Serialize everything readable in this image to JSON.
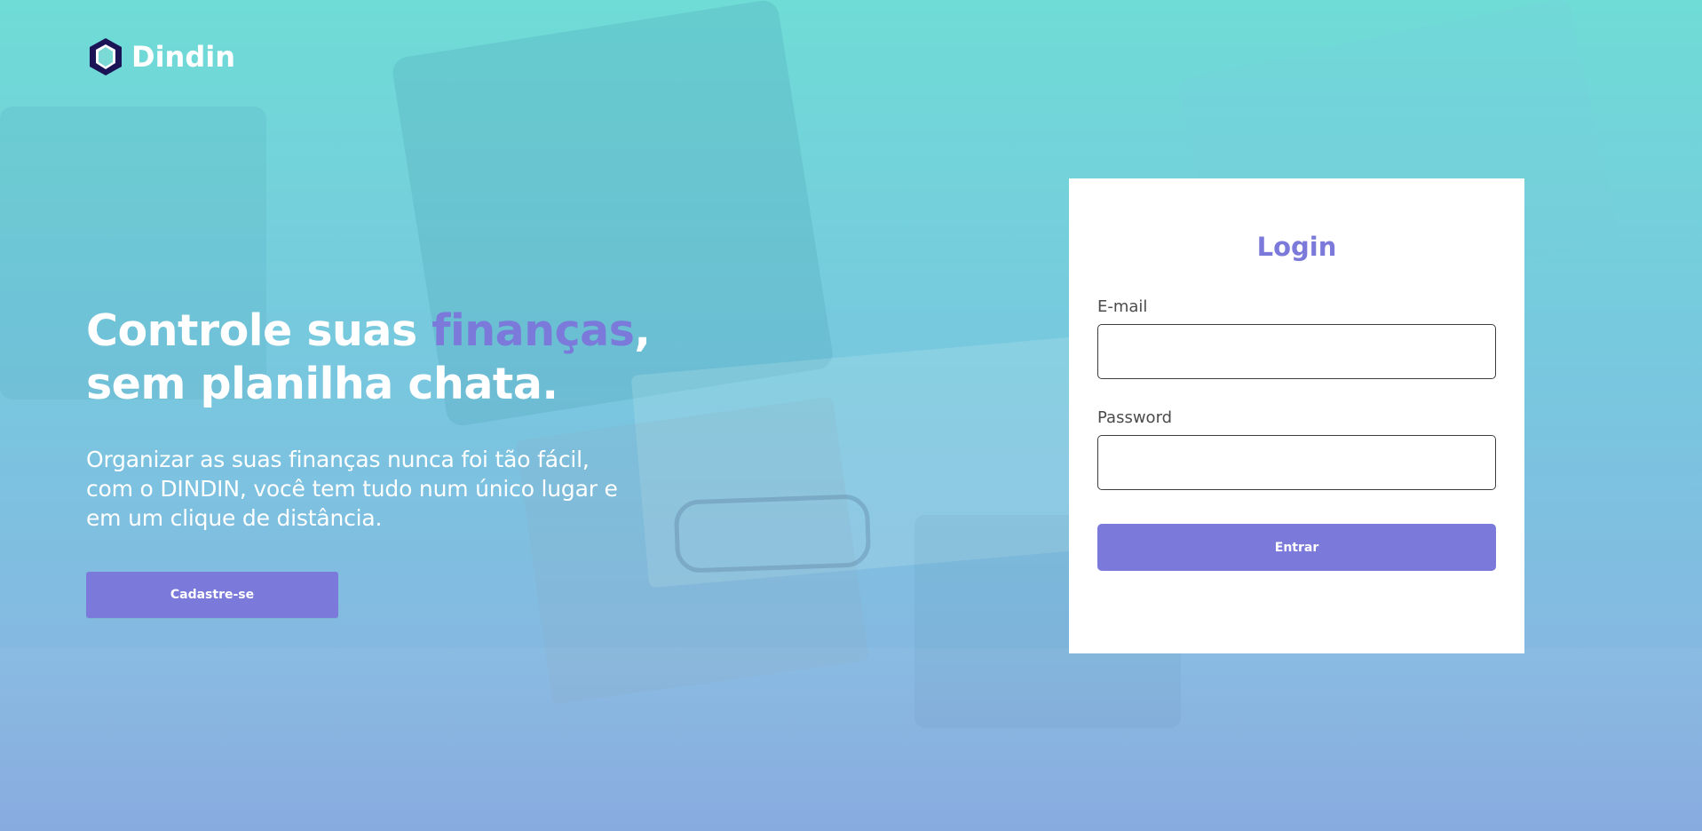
{
  "brand": {
    "name": "Dindin",
    "icon_name": "hexagon-icon",
    "icon_colors": {
      "outer": "#1a1457",
      "inner": "#ffffff"
    }
  },
  "hero": {
    "title_part1": "Controle suas ",
    "title_accent": "finanças",
    "title_part2": ",",
    "title_line2": "sem planilha chata.",
    "description": "Organizar as suas finanças nunca foi tão fácil, com o DINDIN, você tem tudo num único lugar e em um clique de distância.",
    "signup_label": "Cadastre-se"
  },
  "login": {
    "title": "Login",
    "email_label": "E-mail",
    "email_value": "",
    "email_placeholder": "",
    "password_label": "Password",
    "password_value": "",
    "password_placeholder": "",
    "submit_label": "Entrar"
  },
  "colors": {
    "accent": "#7b79da",
    "background_top": "#6fdcd6",
    "background_bottom": "#8db0e2",
    "text_light": "#ffffff",
    "card_background": "#ffffff",
    "label_text": "#4b4b4b"
  }
}
